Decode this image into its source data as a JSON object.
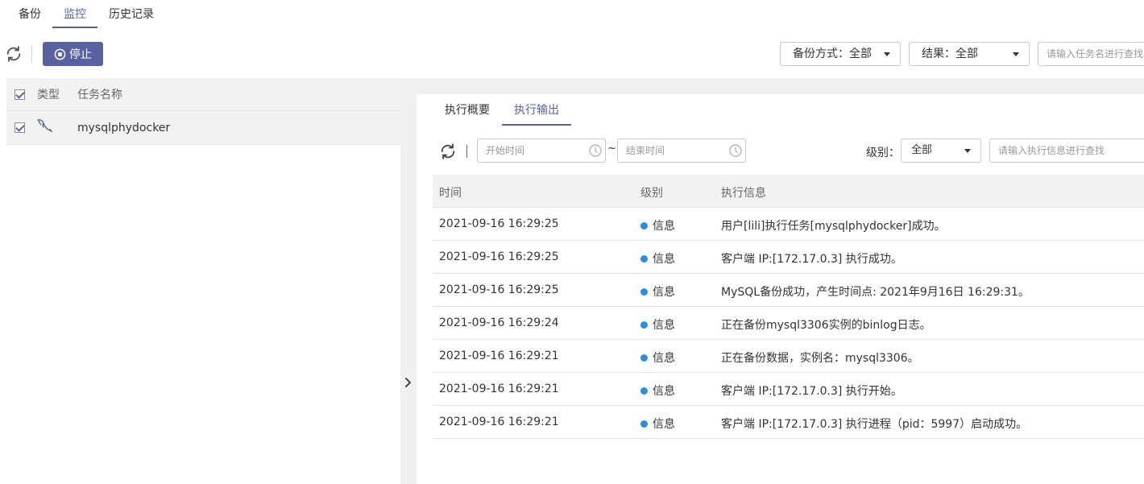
{
  "top_tabs": [
    {
      "label": "备份"
    },
    {
      "label": "监控"
    },
    {
      "label": "历史记录"
    }
  ],
  "toolbar": {
    "stop_label": "停止",
    "backup_method_select": "备份方式：全部",
    "result_select": "结果：全部",
    "task_search_placeholder": "请输入任务名进行查找"
  },
  "task_list": {
    "headers": {
      "type": "类型",
      "name": "任务名称"
    },
    "rows": [
      {
        "name": "mysqlphydocker",
        "type_icon": "mysql-dolphin-icon",
        "checked": true
      }
    ]
  },
  "detail": {
    "tabs": [
      {
        "label": "执行概要"
      },
      {
        "label": "执行输出"
      }
    ],
    "filters": {
      "start_placeholder": "开始时间",
      "end_placeholder": "结束时间",
      "range_separator": "~",
      "level_label": "级别：",
      "level_value": "全部",
      "info_search_placeholder": "请输入执行信息进行查找"
    },
    "log_headers": {
      "time": "时间",
      "level": "级别",
      "info": "执行信息"
    },
    "logs": [
      {
        "time": "2021-09-16 16:29:25",
        "level": "信息",
        "info": "用户[lili]执行任务[mysqlphydocker]成功。"
      },
      {
        "time": "2021-09-16 16:29:25",
        "level": "信息",
        "info": "客户端 IP:[172.17.0.3] 执行成功。"
      },
      {
        "time": "2021-09-16 16:29:25",
        "level": "信息",
        "info": "MySQL备份成功，产生时间点: 2021年9月16日 16:29:31。"
      },
      {
        "time": "2021-09-16 16:29:24",
        "level": "信息",
        "info": "正在备份mysql3306实例的binlog日志。"
      },
      {
        "time": "2021-09-16 16:29:21",
        "level": "信息",
        "info": "正在备份数据，实例名：mysql3306。"
      },
      {
        "time": "2021-09-16 16:29:21",
        "level": "信息",
        "info": "客户端 IP:[172.17.0.3] 执行开始。"
      },
      {
        "time": "2021-09-16 16:29:21",
        "level": "信息",
        "info": "客户端 IP:[172.17.0.3] 执行进程（pid：5997）启动成功。"
      }
    ]
  },
  "colors": {
    "accent": "#5962a0",
    "info_dot": "#2a8de0"
  }
}
